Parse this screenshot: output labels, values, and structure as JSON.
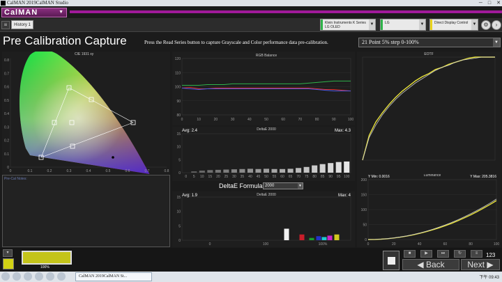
{
  "window": {
    "title": "CalMAN 2019CalMAN Studio",
    "icon": "CM",
    "buttons": [
      "─",
      "□",
      "✕"
    ]
  },
  "app": {
    "logo": "CalMAN",
    "caret": "▼"
  },
  "toolbar": {
    "history_tab": "History 1",
    "icons": [
      "menu-icon",
      "back-icon"
    ],
    "devices": [
      {
        "name": "meter-selector",
        "line1": "Klein Instruments K Series",
        "line2": "LG OLED",
        "stripe": "#2fb34a"
      },
      {
        "name": "display-selector",
        "line1": "LG",
        "line2": "",
        "stripe": "#2fb34a"
      },
      {
        "name": "pattern-selector",
        "line1": "Direct Display Control",
        "line2": "",
        "stripe": "#e8d21a"
      }
    ]
  },
  "page": {
    "title": "Pre Calibration Capture",
    "instruction": "Press the Read Series button to capture Grayscale and Color performance data pre-calibration.",
    "series_option": "21 Point 5% step 0-100%"
  },
  "cie": {
    "title": "CIE 1931 xy",
    "xticks": [
      "0",
      "0.1",
      "0.2",
      "0.3",
      "0.4",
      "0.5",
      "0.6",
      "0.7",
      "0.8"
    ],
    "yticks": [
      "0",
      "0.1",
      "0.2",
      "0.3",
      "0.4",
      "0.5",
      "0.6",
      "0.7",
      "0.8"
    ]
  },
  "notes": {
    "label": "Pre-Cal Notes:"
  },
  "chart_data": [
    {
      "type": "line",
      "title": "RGB Balance",
      "x": [
        0,
        5,
        10,
        15,
        20,
        25,
        30,
        35,
        40,
        45,
        50,
        55,
        60,
        65,
        70,
        75,
        80,
        85,
        90,
        95,
        100
      ],
      "xlim": [
        0,
        100
      ],
      "ylim": [
        80,
        120
      ],
      "xticks": [
        "0",
        "10",
        "20",
        "30",
        "40",
        "50",
        "60",
        "70",
        "80",
        "90",
        "100"
      ],
      "yticks": [
        "120",
        "110",
        "100",
        "90",
        "80"
      ],
      "series": [
        {
          "color": "#e23030",
          "values": [
            99,
            99.5,
            98.5,
            98.5,
            99,
            99,
            99,
            99,
            99,
            99,
            99,
            99,
            99,
            99,
            99,
            99,
            98.5,
            98,
            98,
            97.5,
            97
          ]
        },
        {
          "color": "#2fb34a",
          "values": [
            101,
            101,
            101,
            101.5,
            101.5,
            101.5,
            102,
            102,
            102,
            102,
            102,
            102,
            102,
            102,
            102,
            102.5,
            103,
            103.5,
            104,
            104,
            104
          ]
        },
        {
          "color": "#4a58e8",
          "values": [
            99,
            98.5,
            98,
            98.5,
            98.5,
            98.5,
            98.5,
            98.5,
            98.5,
            98.5,
            98.5,
            98.5,
            98.5,
            98.5,
            98.5,
            98.5,
            98,
            97.5,
            97,
            97,
            97
          ]
        }
      ]
    },
    {
      "type": "bar",
      "title": "DeltaE 2000",
      "avg_label": "Avg: 2.4",
      "max_label": "Max: 4.3",
      "categories": [
        "0",
        "5",
        "10",
        "15",
        "20",
        "25",
        "30",
        "35",
        "40",
        "45",
        "50",
        "55",
        "60",
        "65",
        "70",
        "75",
        "80",
        "85",
        "90",
        "95",
        "100"
      ],
      "values": [
        0,
        0.5,
        0.8,
        1,
        1.1,
        1.2,
        1.3,
        1.4,
        1.5,
        1.4,
        1.5,
        1.4,
        1.4,
        1.5,
        1.8,
        2.2,
        2.8,
        3.3,
        3.7,
        4.1,
        4.3
      ],
      "ylim": [
        0,
        15
      ],
      "yticks": [
        "15",
        "10",
        "5",
        "0"
      ]
    },
    {
      "type": "bar",
      "title": "DeltaE 2000",
      "avg_label": "Avg: 1.9",
      "max_label": "Max: 4",
      "categories": [
        "W",
        "R",
        "G",
        "B",
        "C",
        "M",
        "Y"
      ],
      "values": [
        4,
        2,
        0.8,
        1.4,
        1.1,
        1.6,
        2
      ],
      "colors": [
        "#f2f2f2",
        "#c81e2a",
        "#1aa12e",
        "#2233c8",
        "#1ec8d2",
        "#cc26c6",
        "#d2c81e"
      ],
      "xticks": [
        "0",
        "100",
        "100%"
      ],
      "ylim": [
        0,
        15
      ],
      "yticks": [
        "15",
        "10",
        "5",
        "0"
      ]
    },
    {
      "type": "line",
      "title": "EOTF",
      "xlim": [
        0,
        100
      ],
      "ylim": [
        0,
        1
      ],
      "series": [
        {
          "color": "#e8e23a",
          "values": [
            0,
            0.24,
            0.37,
            0.46,
            0.54,
            0.61,
            0.67,
            0.72,
            0.77,
            0.81,
            0.84,
            0.88,
            0.9,
            0.93,
            0.95,
            0.97,
            0.99,
            1.0,
            1.0,
            1.0,
            1.0
          ]
        },
        {
          "color": "#cccccc",
          "values": [
            0,
            0.22,
            0.34,
            0.44,
            0.52,
            0.59,
            0.65,
            0.7,
            0.75,
            0.79,
            0.83,
            0.87,
            0.9,
            0.92,
            0.95,
            0.97,
            0.98,
            0.99,
            1.0,
            1.0,
            1.0
          ]
        }
      ]
    },
    {
      "type": "line",
      "title": "Luminance",
      "min_label": "Y Min: 0.0016",
      "max_label": "Y Max: 205.3816",
      "xlim": [
        0,
        100
      ],
      "ylim": [
        0,
        200
      ],
      "xticks": [
        "0",
        "20",
        "40",
        "60",
        "80",
        "100"
      ],
      "yticks": [
        "200",
        "150",
        "100",
        "50",
        "0"
      ],
      "series": [
        {
          "color": "#e8e23a",
          "values": [
            0,
            0.3,
            1.2,
            2.8,
            5,
            8,
            11.5,
            15.6,
            20.5,
            26,
            32,
            38.7,
            46,
            54,
            62.8,
            72.3,
            82.4,
            93.3,
            105,
            117,
            130
          ]
        },
        {
          "color": "#cccccc",
          "values": [
            0,
            0.3,
            1.3,
            3,
            5.4,
            8.5,
            12.2,
            16.6,
            21.7,
            27.4,
            33.8,
            40.9,
            48.6,
            57,
            66.1,
            75.9,
            86.3,
            97.4,
            109,
            121.7,
            135
          ]
        }
      ]
    }
  ],
  "delta_formula": {
    "label": "DeltaE Formula",
    "value": "2000"
  },
  "swatch": {
    "label": "100%",
    "color": "#c4c41a"
  },
  "nav": {
    "back": "Back",
    "next": "Next",
    "counter": "123"
  },
  "taskbar": {
    "task": "CalMAN 2019CalMAN St...",
    "clock": "下午 09:43"
  }
}
